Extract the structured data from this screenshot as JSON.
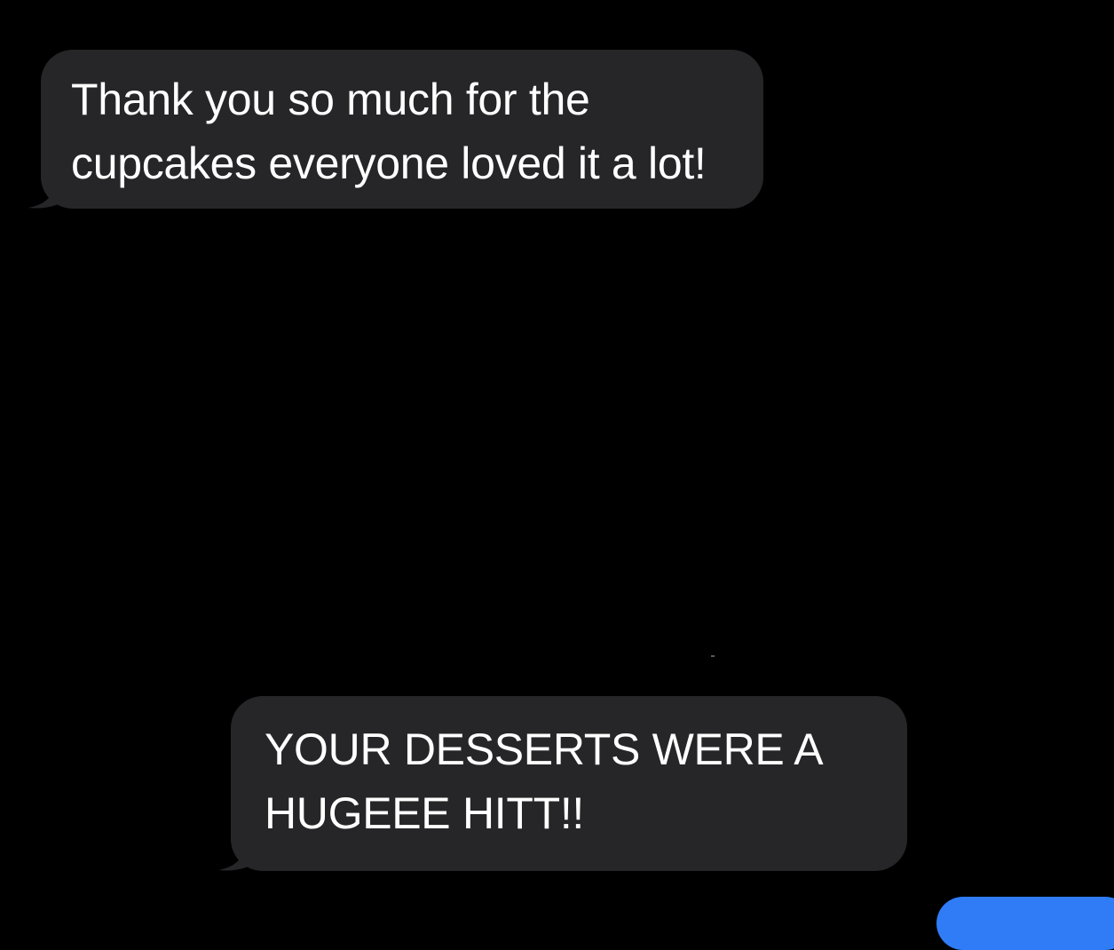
{
  "conversation": {
    "messages": [
      {
        "direction": "incoming",
        "lines": [
          "Thank you so much for the",
          "cupcakes everyone loved it a lot!"
        ]
      },
      {
        "direction": "incoming",
        "lines": [
          "YOUR DESSERTS WERE A",
          "HUGEEE HITT!!"
        ]
      },
      {
        "direction": "outgoing",
        "lines": []
      }
    ]
  },
  "colors": {
    "background": "#000000",
    "incoming_bubble": "#262628",
    "outgoing_bubble": "#2f7cf6",
    "text": "#ffffff"
  }
}
